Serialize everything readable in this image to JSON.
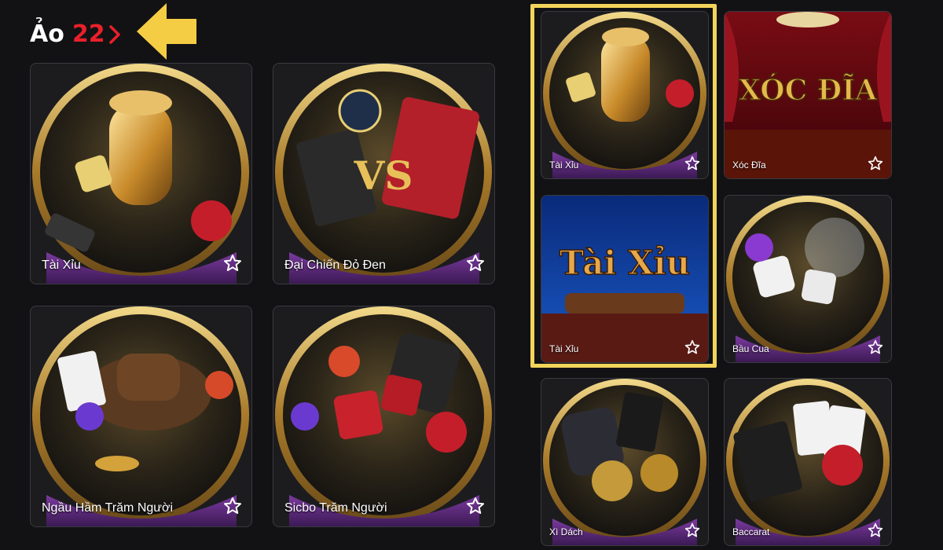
{
  "header": {
    "title": "Ảo",
    "count": "22"
  },
  "colors": {
    "accent_red": "#e8202a",
    "highlight": "#f3d45a",
    "arrow": "#f5cd45",
    "gold": "#c9a24a",
    "purple_band": "#5b2a78"
  },
  "left_grid": [
    {
      "label": "Tài Xỉu",
      "art_text": "Tài Xỉu",
      "icon": "star-icon"
    },
    {
      "label": "Đại Chiến Đỏ Đen",
      "art_text": "Đại Chiến Đỏ Đen",
      "icon": "star-icon"
    },
    {
      "label": "Ngầu Hầm Trăm Người",
      "art_text": "Ngầu Hầm Trăm Người",
      "icon": "star-icon"
    },
    {
      "label": "Sicbo Trăm Người",
      "art_text": "Sicbo Trăm Người",
      "icon": "star-icon"
    }
  ],
  "right_grid": [
    {
      "label": "Tài Xỉu",
      "art_text": "Tài Xỉu",
      "icon": "star-icon"
    },
    {
      "label": "Xóc Đĩa",
      "art_text": "XÓC ĐĨA",
      "icon": "star-icon"
    },
    {
      "label": "Tài Xỉu",
      "art_text": "Tài Xỉu",
      "icon": "star-icon"
    },
    {
      "label": "Bầu Cua",
      "art_text": "Bầu Cua",
      "icon": "star-icon"
    },
    {
      "label": "Xì Dách",
      "art_text": "Xì dách",
      "icon": "star-icon"
    },
    {
      "label": "Baccarat",
      "art_text": "Baccarat",
      "icon": "star-icon"
    }
  ]
}
